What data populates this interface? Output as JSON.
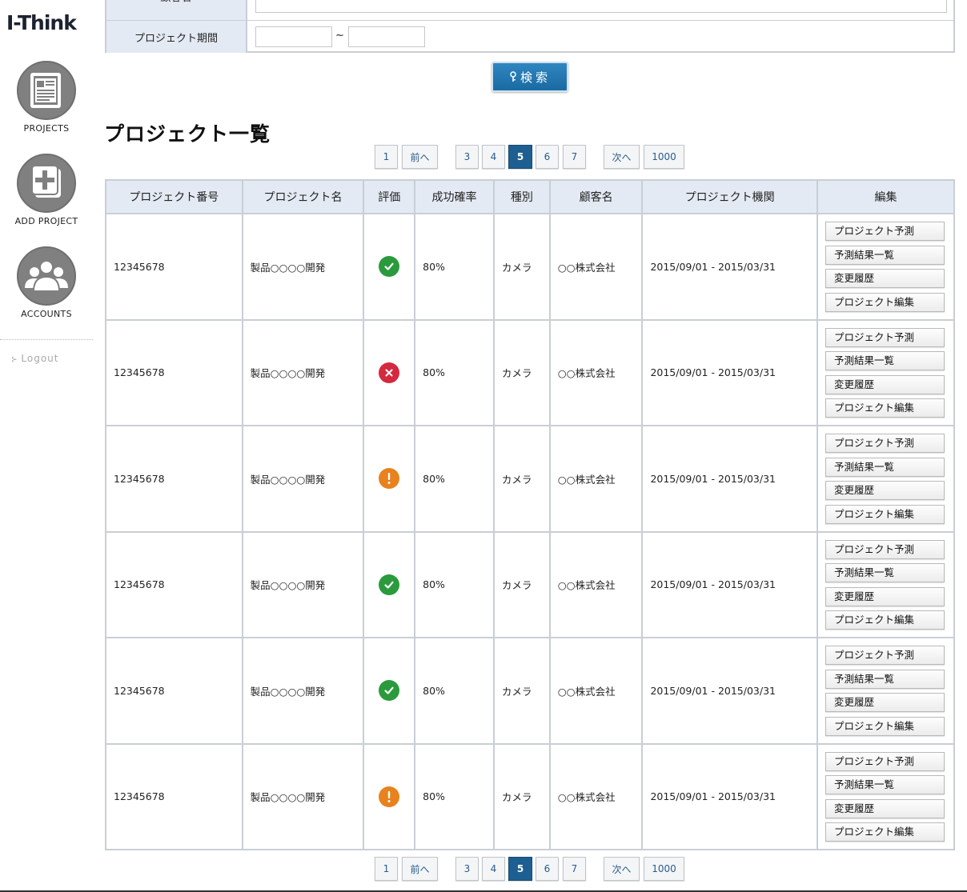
{
  "app": {
    "logo": "I-Think"
  },
  "sidebar": {
    "items": [
      {
        "label": "PROJECTS",
        "icon": "document-icon"
      },
      {
        "label": "ADD PROJECT",
        "icon": "plus-icon"
      },
      {
        "label": "ACCOUNTS",
        "icon": "users-icon"
      }
    ],
    "logout": "Logout"
  },
  "search": {
    "customer_label": "顧客名",
    "period_label": "プロジェクト期間",
    "customer_value": "",
    "period_from": "",
    "period_to": "",
    "tilde": "~",
    "button_label": "検索"
  },
  "list": {
    "title": "プロジェクト一覧"
  },
  "pagination": {
    "first": "1",
    "prev": "前へ",
    "pages": [
      "3",
      "4",
      "5",
      "6",
      "7"
    ],
    "current": "5",
    "next": "次へ",
    "last": "1000"
  },
  "table": {
    "columns": [
      "プロジェクト番号",
      "プロジェクト名",
      "評価",
      "成功確率",
      "種別",
      "顧客名",
      "プロジェクト機関",
      "編集"
    ],
    "edit_actions": [
      "プロジェクト予測",
      "予測結果一覧",
      "変更履歴",
      "プロジェクト編集"
    ],
    "rows": [
      {
        "number": "12345678",
        "name": "製品○○○○開発",
        "status": "ok",
        "probability": "80%",
        "type": "カメラ",
        "customer": "○○株式会社",
        "period": "2015/09/01 - 2015/03/31"
      },
      {
        "number": "12345678",
        "name": "製品○○○○開発",
        "status": "ng",
        "probability": "80%",
        "type": "カメラ",
        "customer": "○○株式会社",
        "period": "2015/09/01 - 2015/03/31"
      },
      {
        "number": "12345678",
        "name": "製品○○○○開発",
        "status": "warn",
        "probability": "80%",
        "type": "カメラ",
        "customer": "○○株式会社",
        "period": "2015/09/01 - 2015/03/31"
      },
      {
        "number": "12345678",
        "name": "製品○○○○開発",
        "status": "ok",
        "probability": "80%",
        "type": "カメラ",
        "customer": "○○株式会社",
        "period": "2015/09/01 - 2015/03/31"
      },
      {
        "number": "12345678",
        "name": "製品○○○○開発",
        "status": "ok",
        "probability": "80%",
        "type": "カメラ",
        "customer": "○○株式会社",
        "period": "2015/09/01 - 2015/03/31"
      },
      {
        "number": "12345678",
        "name": "製品○○○○開発",
        "status": "warn",
        "probability": "80%",
        "type": "カメラ",
        "customer": "○○株式会社",
        "period": "2015/09/01 - 2015/03/31"
      }
    ]
  },
  "colors": {
    "accent": "#1d5f91",
    "ok": "#2a9a3c",
    "ng": "#d42a3e",
    "warn": "#e8821e"
  }
}
